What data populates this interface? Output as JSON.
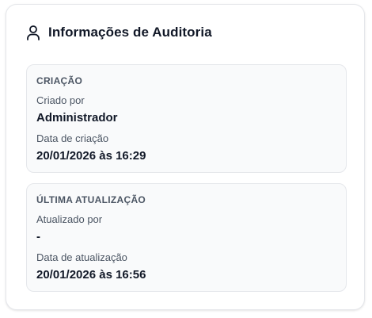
{
  "card": {
    "title": "Informações de Auditoria",
    "icon": "user-icon"
  },
  "creation": {
    "section_title": "CRIAÇÃO",
    "created_by_label": "Criado por",
    "created_by_value": "Administrador",
    "created_at_label": "Data de criação",
    "created_at_value": "20/01/2026 às 16:29"
  },
  "update": {
    "section_title": "ÚLTIMA ATUALIZAÇÃO",
    "updated_by_label": "Atualizado por",
    "updated_by_value": "-",
    "updated_at_label": "Data de atualização",
    "updated_at_value": "20/01/2026 às 16:56"
  }
}
